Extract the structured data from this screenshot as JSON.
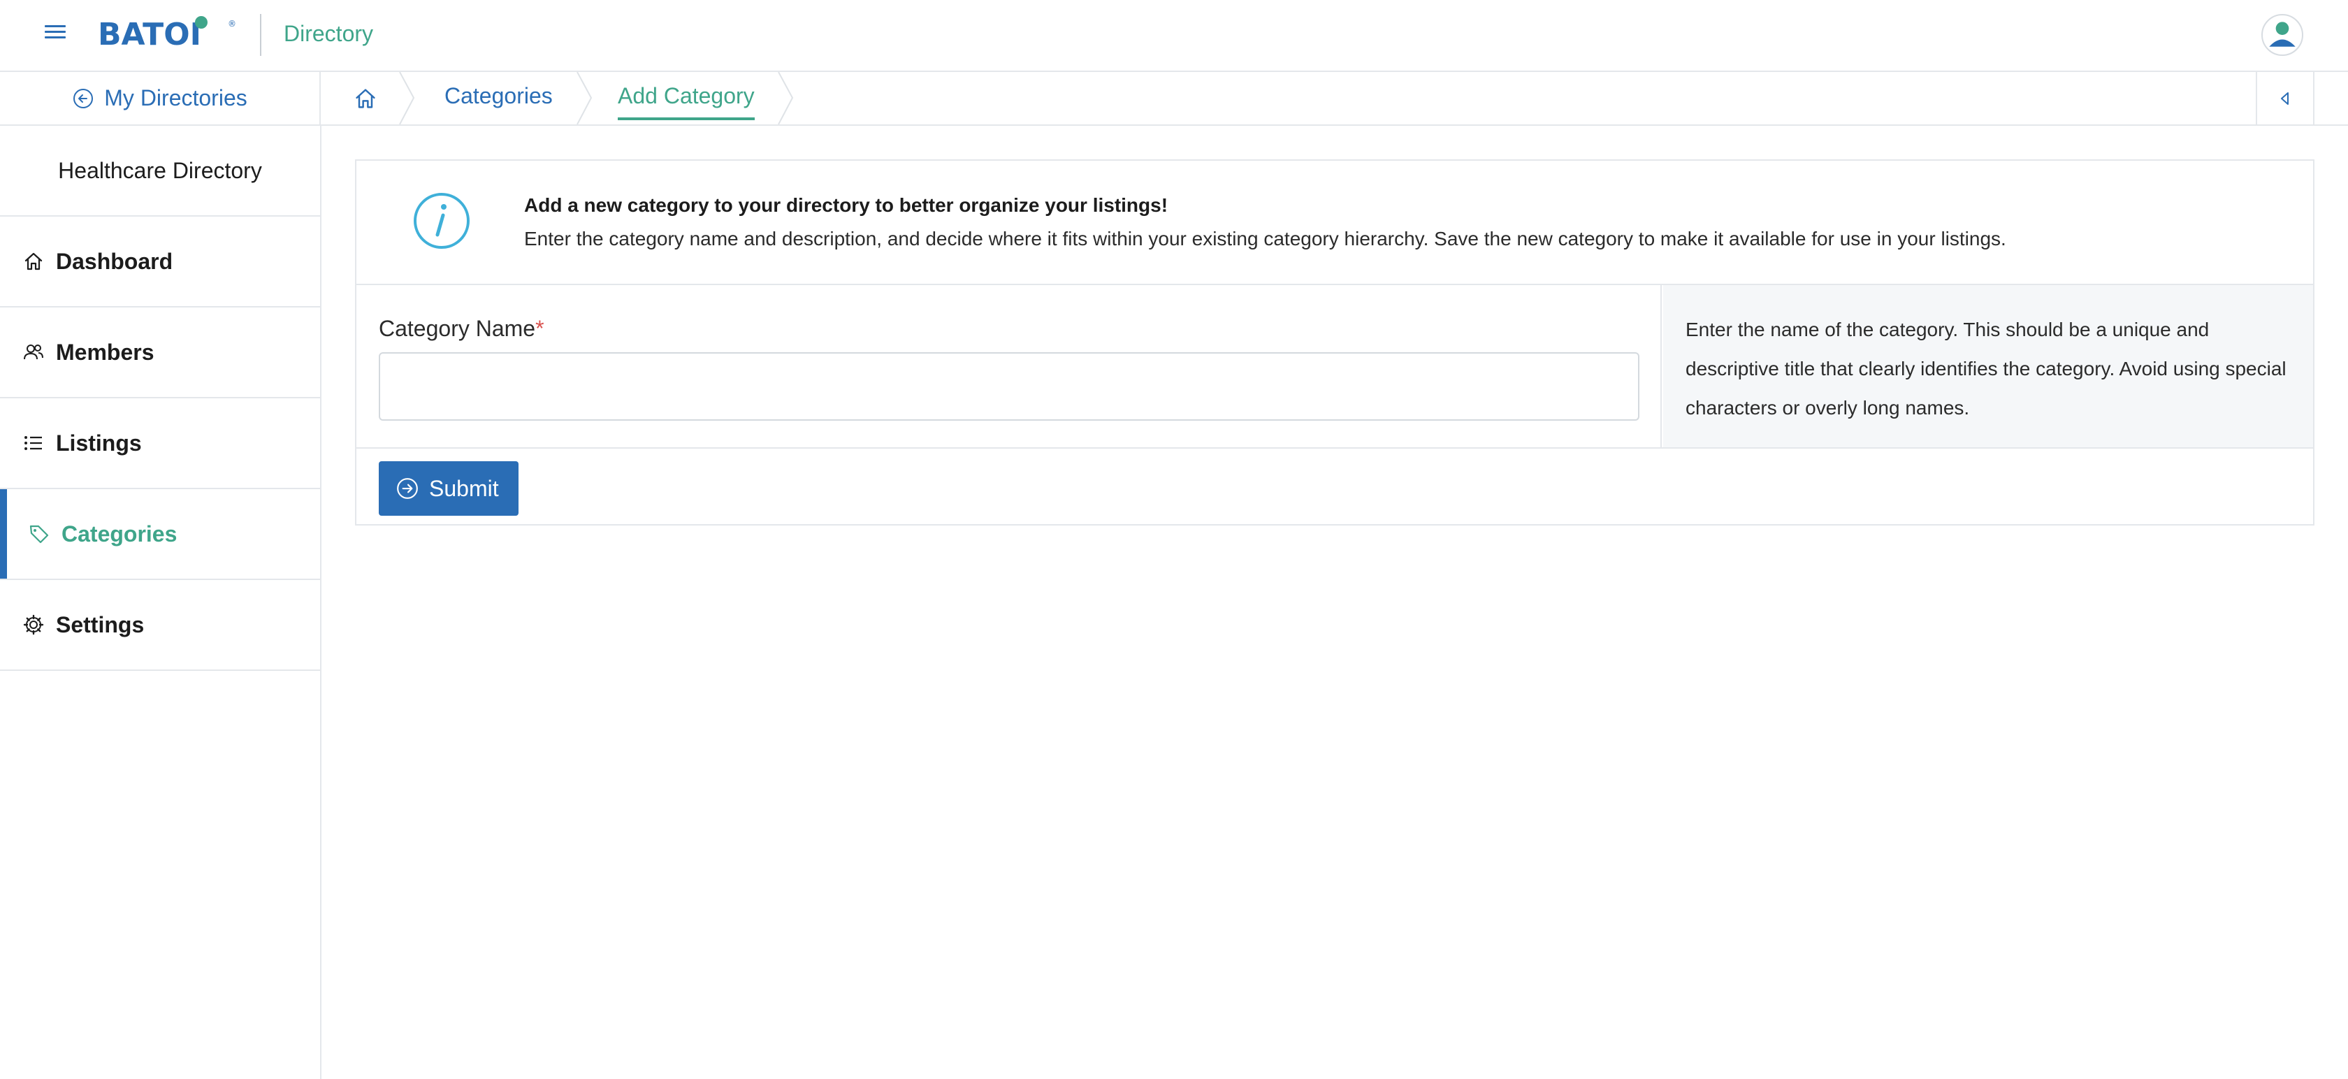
{
  "header": {
    "menu_icon": "hamburger-icon",
    "logo_text": "BATOI",
    "app_title": "Directory",
    "avatar_icon": "user-avatar-icon"
  },
  "breadcrumb": {
    "back_label": "My Directories",
    "back_icon": "arrow-left-circle-icon",
    "home_icon": "home-icon",
    "items": [
      {
        "label": "Categories"
      },
      {
        "label": "Add Category"
      }
    ],
    "collapse_icon": "caret-left-icon"
  },
  "sidebar": {
    "directory_name": "Healthcare Directory",
    "items": [
      {
        "label": "Dashboard",
        "icon": "home-icon"
      },
      {
        "label": "Members",
        "icon": "users-icon"
      },
      {
        "label": "Listings",
        "icon": "list-icon"
      },
      {
        "label": "Categories",
        "icon": "tag-icon",
        "active": true
      },
      {
        "label": "Settings",
        "icon": "gear-icon"
      }
    ]
  },
  "info": {
    "icon": "info-icon",
    "title": "Add a new category to your directory to better organize your listings!",
    "text": "Enter the category name and description, and decide where it fits within your existing category hierarchy. Save the new category to make it available for use in your listings."
  },
  "form": {
    "category_name_label": "Category Name",
    "required_mark": "*",
    "category_name_value": "",
    "help_text": "Enter the name of the category. This should be a unique and descriptive title that clearly identifies the category. Avoid using special characters or overly long names.",
    "submit_label": "Submit",
    "submit_icon": "arrow-right-circle-icon"
  },
  "colors": {
    "primary": "#2a6db5",
    "accent": "#3fa58a",
    "info_icon": "#3fb0d9",
    "border": "#e4e7eb",
    "help_bg": "#f5f7f9"
  }
}
